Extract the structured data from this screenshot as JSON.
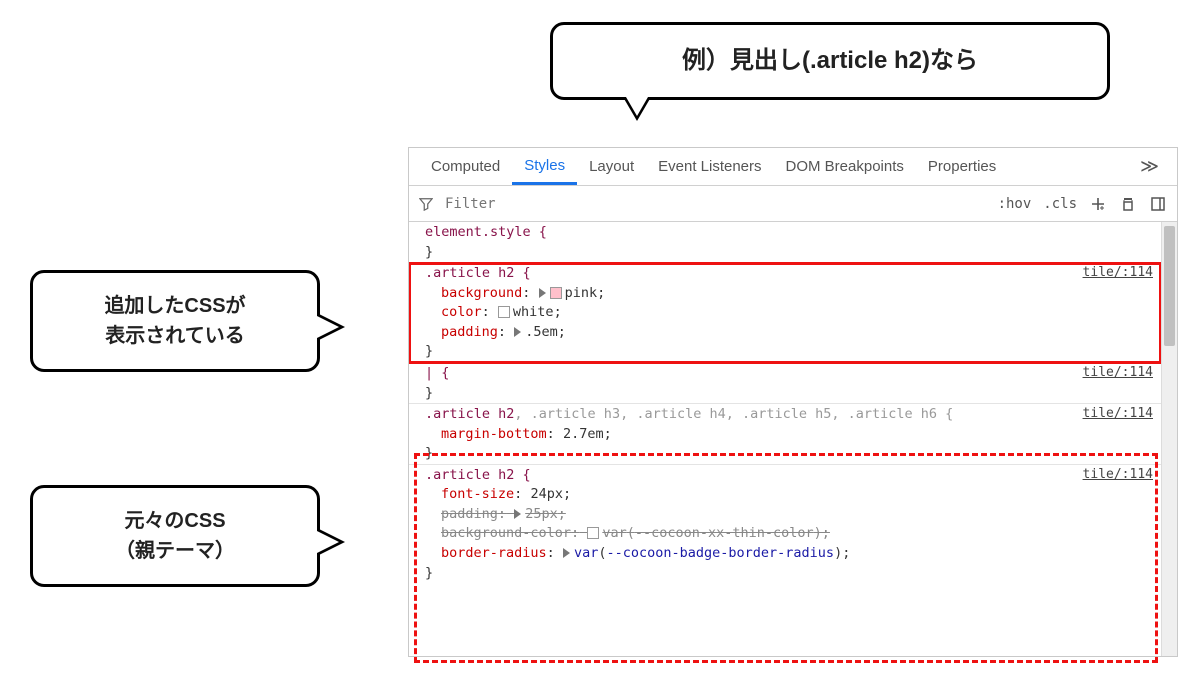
{
  "annotations": {
    "top": "例）見出し(.article h2)なら",
    "mid_l1": "追加したCSSが",
    "mid_l2": "表示されている",
    "low_l1": "元々のCSS",
    "low_l2": "（親テーマ）"
  },
  "tabs": {
    "computed": "Computed",
    "styles": "Styles",
    "layout": "Layout",
    "listeners": "Event Listeners",
    "dom": "DOM Breakpoints",
    "props": "Properties",
    "more": "≫"
  },
  "filter": {
    "placeholder": "Filter",
    "hov": ":hov",
    "cls": ".cls"
  },
  "rules": {
    "elstyle_open": "element.style {",
    "close_brace": "}",
    "r1": {
      "selector": ".article h2 {",
      "src": "tile/:114",
      "d1_prop": "background",
      "d1_val": "pink",
      "d2_prop": "color",
      "d2_val": "white",
      "d3_prop": "padding",
      "d3_val": ".5em"
    },
    "anon": {
      "selector": "| {",
      "src": "tile/:114"
    },
    "r2": {
      "selector_main": ".article h2",
      "selector_rest": ", .article h3, .article h4, .article h5, .article h6 {",
      "src": "tile/:114",
      "d1_prop": "margin-bottom",
      "d1_val": "2.7em"
    },
    "r3": {
      "selector": ".article h2 {",
      "src": "tile/:114",
      "d1_prop": "font-size",
      "d1_val": "24px",
      "d2_prop": "padding",
      "d2_val": "25px",
      "d3_prop": "background-color",
      "d3_varfn": "var",
      "d3_varname": "--cocoon-xx-thin-color",
      "d4_prop": "border-radius",
      "d4_varfn": "var",
      "d4_varname": "--cocoon-badge-border-radius"
    }
  }
}
